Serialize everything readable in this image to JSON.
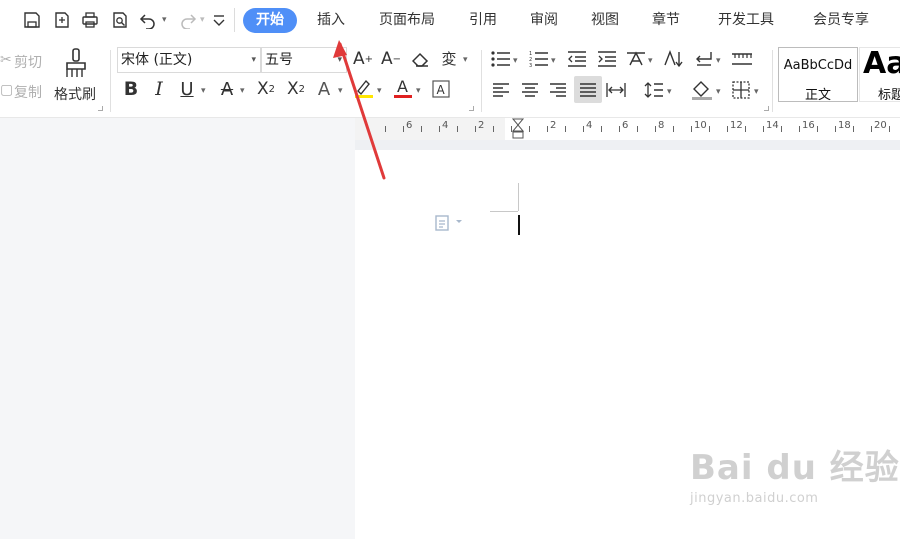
{
  "tabs": [
    {
      "label": "开始",
      "active": true
    },
    {
      "label": "插入"
    },
    {
      "label": "页面布局"
    },
    {
      "label": "引用"
    },
    {
      "label": "审阅"
    },
    {
      "label": "视图"
    },
    {
      "label": "章节"
    },
    {
      "label": "开发工具"
    },
    {
      "label": "会员专享"
    }
  ],
  "clipboard": {
    "cut_label": "剪切",
    "copy_label": "复制",
    "format_painter_label": "格式刷"
  },
  "font": {
    "name": "宋体 (正文)",
    "size": "五号"
  },
  "styles": {
    "normal_preview": "AaBbCcDd",
    "normal_label": "正文",
    "heading_preview": "Aa",
    "heading_label": "标题"
  },
  "ruler": {
    "numbers": [
      "6",
      "4",
      "2",
      "2",
      "4",
      "6",
      "8",
      "10",
      "12",
      "14",
      "16",
      "18",
      "20"
    ]
  },
  "watermark": {
    "brand": "Bai du 经验",
    "site": "jingyan.baidu.com"
  },
  "colors": {
    "accent": "#4f8ff7",
    "highlight": "#ffe600",
    "font_color": "#e02020",
    "arrow": "#e03a3a"
  }
}
